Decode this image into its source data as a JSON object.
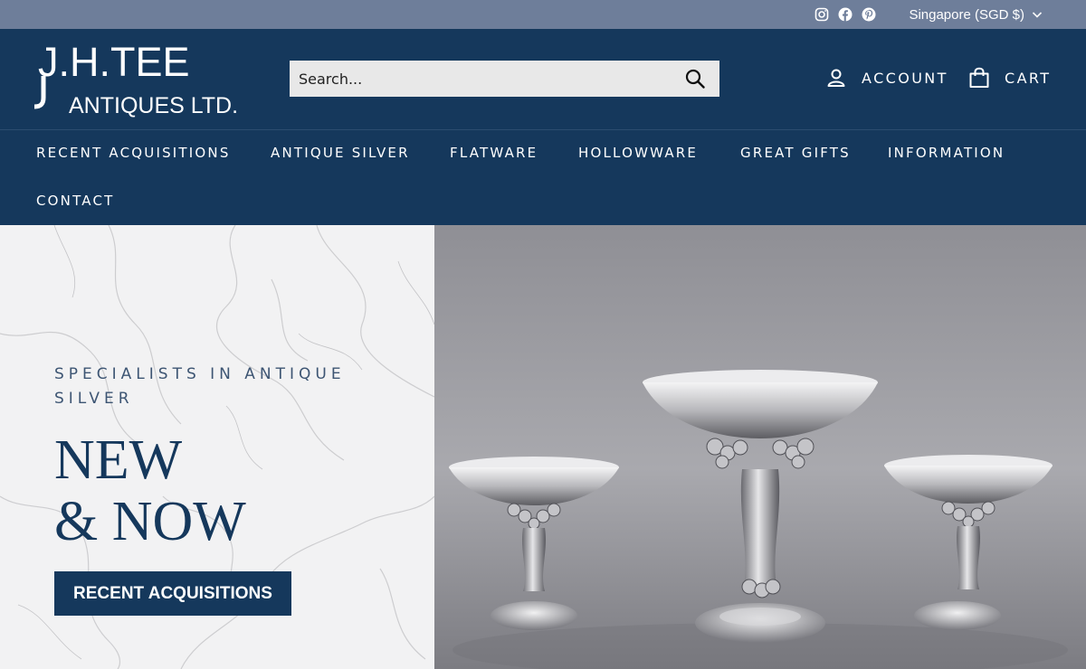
{
  "topbar": {
    "social": [
      "instagram-icon",
      "facebook-icon",
      "pinterest-icon"
    ],
    "locale": "Singapore (SGD $)"
  },
  "header": {
    "logo_line1": "J.H.TEE",
    "logo_line2": "ANTIQUES LTD.",
    "search_placeholder": "Search...",
    "account_label": "ACCOUNT",
    "cart_label": "CART"
  },
  "nav": {
    "items": [
      "RECENT ACQUISITIONS",
      "ANTIQUE SILVER",
      "FLATWARE",
      "HOLLOWWARE",
      "GREAT GIFTS",
      "INFORMATION",
      "CONTACT"
    ]
  },
  "hero": {
    "eyebrow": "SPECIALISTS IN ANTIQUE SILVER",
    "headline_line1": "NEW",
    "headline_line2": "& NOW",
    "cta_label": "RECENT ACQUISITIONS",
    "image_alt": "three silver tazzas with grape cluster decoration"
  },
  "colors": {
    "brand_navy": "#15385c",
    "topbar": "#6e7e9a",
    "eyebrow_text": "#3d5573"
  }
}
